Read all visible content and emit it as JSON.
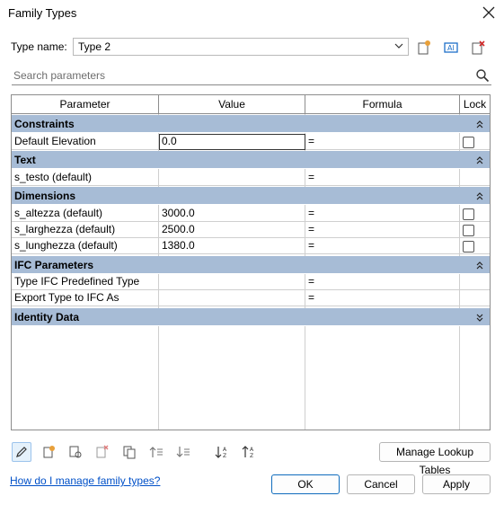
{
  "window": {
    "title": "Family Types"
  },
  "type_name": {
    "label": "Type name:",
    "value": "Type 2"
  },
  "search": {
    "placeholder": "Search parameters"
  },
  "table": {
    "headers": {
      "parameter": "Parameter",
      "value": "Value",
      "formula": "Formula",
      "lock": "Lock"
    },
    "groups": {
      "constraints": "Constraints",
      "text": "Text",
      "dimensions": "Dimensions",
      "ifc": "IFC Parameters",
      "identity": "Identity Data"
    },
    "rows": {
      "default_elevation": {
        "parameter": "Default Elevation",
        "value": "0.0",
        "formula": "="
      },
      "s_testo": {
        "parameter": "s_testo (default)",
        "value": "",
        "formula": "="
      },
      "s_altezza": {
        "parameter": "s_altezza (default)",
        "value": "3000.0",
        "formula": "="
      },
      "s_larghezza": {
        "parameter": "s_larghezza (default)",
        "value": "2500.0",
        "formula": "="
      },
      "s_lunghezza": {
        "parameter": "s_lunghezza (default)",
        "value": "1380.0",
        "formula": "="
      },
      "ifc_predefined": {
        "parameter": "Type IFC Predefined Type",
        "value": "",
        "formula": "="
      },
      "export_ifc": {
        "parameter": "Export Type to IFC As",
        "value": "",
        "formula": "="
      }
    }
  },
  "buttons": {
    "manage_lookup": "Manage Lookup Tables",
    "ok": "OK",
    "cancel": "Cancel",
    "apply": "Apply"
  },
  "help_link": "How do I manage family types?",
  "colors": {
    "group_bg": "#a7bcd6",
    "link": "#0050c8",
    "accent": "#0f6cbd"
  }
}
